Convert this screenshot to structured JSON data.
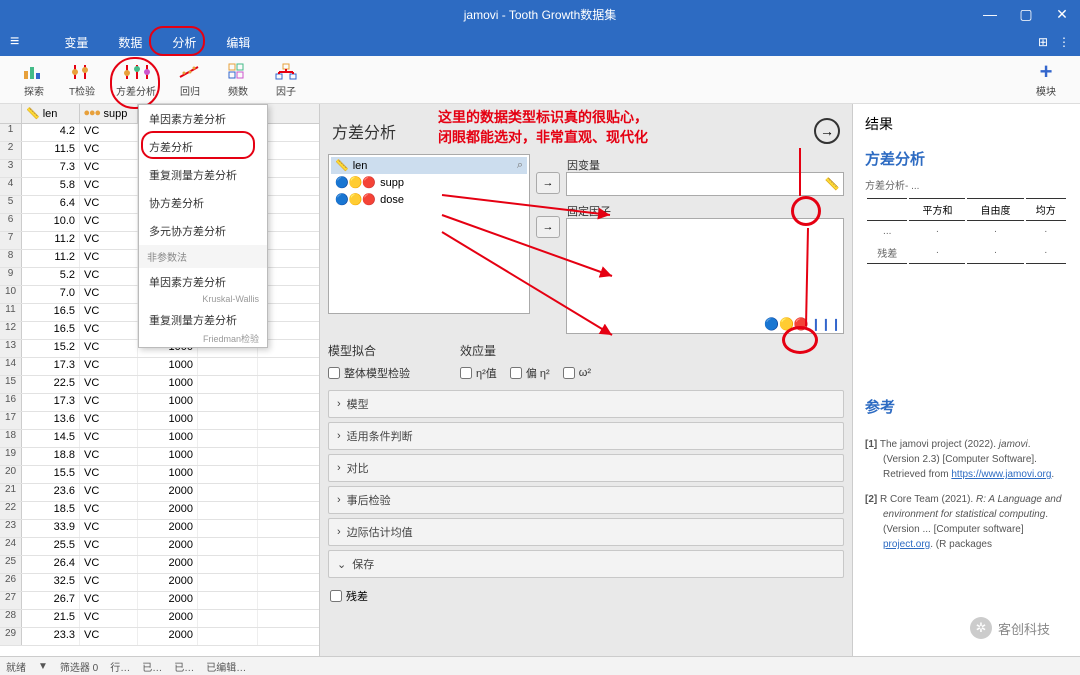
{
  "app": {
    "title": "jamovi - Tooth Growth数据集"
  },
  "menu": {
    "hamburger": "≡",
    "items": [
      "变量",
      "数据",
      "分析",
      "编辑"
    ],
    "active": 2
  },
  "toolbar": {
    "explore": "探索",
    "ttest": "T检验",
    "anova": "方差分析",
    "regression": "回归",
    "freq": "频数",
    "factor": "因子",
    "modules": "模块"
  },
  "dropdown": {
    "items": [
      "单因素方差分析",
      "方差分析",
      "重复测量方差分析",
      "协方差分析",
      "多元协方差分析"
    ],
    "section": "非参数法",
    "np": [
      {
        "label": "单因素方差分析",
        "sub": "Kruskal-Wallis"
      },
      {
        "label": "重复测量方差分析",
        "sub": "Friedman检验"
      }
    ]
  },
  "sheet": {
    "cols": [
      {
        "name": "len",
        "type": "continuous"
      },
      {
        "name": "supp",
        "type": "nominal"
      },
      {
        "name": "dose",
        "type": "nominal"
      }
    ],
    "widths": [
      58,
      58,
      60,
      60,
      60
    ],
    "rows": [
      [
        "4.2",
        "VC",
        ""
      ],
      [
        "11.5",
        "VC",
        ""
      ],
      [
        "7.3",
        "VC",
        ""
      ],
      [
        "5.8",
        "VC",
        ""
      ],
      [
        "6.4",
        "VC",
        ""
      ],
      [
        "10.0",
        "VC",
        ""
      ],
      [
        "11.2",
        "VC",
        ""
      ],
      [
        "11.2",
        "VC",
        ""
      ],
      [
        "5.2",
        "VC",
        ""
      ],
      [
        "7.0",
        "VC",
        ""
      ],
      [
        "16.5",
        "VC",
        ""
      ],
      [
        "16.5",
        "VC",
        "1000"
      ],
      [
        "15.2",
        "VC",
        "1000"
      ],
      [
        "17.3",
        "VC",
        "1000"
      ],
      [
        "22.5",
        "VC",
        "1000"
      ],
      [
        "17.3",
        "VC",
        "1000"
      ],
      [
        "13.6",
        "VC",
        "1000"
      ],
      [
        "14.5",
        "VC",
        "1000"
      ],
      [
        "18.8",
        "VC",
        "1000"
      ],
      [
        "15.5",
        "VC",
        "1000"
      ],
      [
        "23.6",
        "VC",
        "2000"
      ],
      [
        "18.5",
        "VC",
        "2000"
      ],
      [
        "33.9",
        "VC",
        "2000"
      ],
      [
        "25.5",
        "VC",
        "2000"
      ],
      [
        "26.4",
        "VC",
        "2000"
      ],
      [
        "32.5",
        "VC",
        "2000"
      ],
      [
        "26.7",
        "VC",
        "2000"
      ],
      [
        "21.5",
        "VC",
        "2000"
      ],
      [
        "23.3",
        "VC",
        "2000"
      ]
    ]
  },
  "panel": {
    "title": "方差分析",
    "vars": [
      {
        "name": "len",
        "type": "continuous",
        "selected": true
      },
      {
        "name": "supp",
        "type": "nominal",
        "selected": false
      },
      {
        "name": "dose",
        "type": "nominal",
        "selected": false
      }
    ],
    "search": "⌕",
    "targets": {
      "dependent": "因变量",
      "fixed": "固定因子"
    },
    "fit_label": "模型拟合",
    "fit_checkbox": "整体模型检验",
    "effect_label": "效应量",
    "eta2": "η²值",
    "peta2": "偏 η²",
    "omega2": "ω²",
    "accordions": [
      "模型",
      "适用条件判断",
      "对比",
      "事后检验",
      "边际估计均值",
      "保存"
    ],
    "residual": "残差"
  },
  "results": {
    "title": "结果",
    "section": "方差分析",
    "tablecap": "方差分析- ...",
    "thead": [
      "",
      "平方和",
      "自由度",
      "均方"
    ],
    "rows": [
      [
        "...",
        "·",
        "·",
        "·"
      ],
      [
        "残差",
        "·",
        "·",
        "·"
      ]
    ],
    "refs_title": "参考",
    "refs": [
      {
        "n": "[1]",
        "text": "The jamovi project (2022). ",
        "em": "jamovi",
        "tail": ". (Version 2.3) [Computer Software]. Retrieved from ",
        "link": "https://www.jamovi.org",
        "post": "."
      },
      {
        "n": "[2]",
        "text": "R Core Team (2021). ",
        "em": "R: A Language and environment for statistical computing",
        "tail": ". (Version ... [Computer software] ",
        "link": "project.org",
        "post": ". (R packages"
      }
    ]
  },
  "annotation": "这里的数据类型标识真的很贴心，\n闭眼都能选对，非常直观、现代化",
  "status": {
    "ready": "就绪",
    "filter": "筛选器 0",
    "row": "行…",
    "add": "已…",
    "del": "已…",
    "edit": "已编辑…"
  },
  "watermark": "客创科技"
}
